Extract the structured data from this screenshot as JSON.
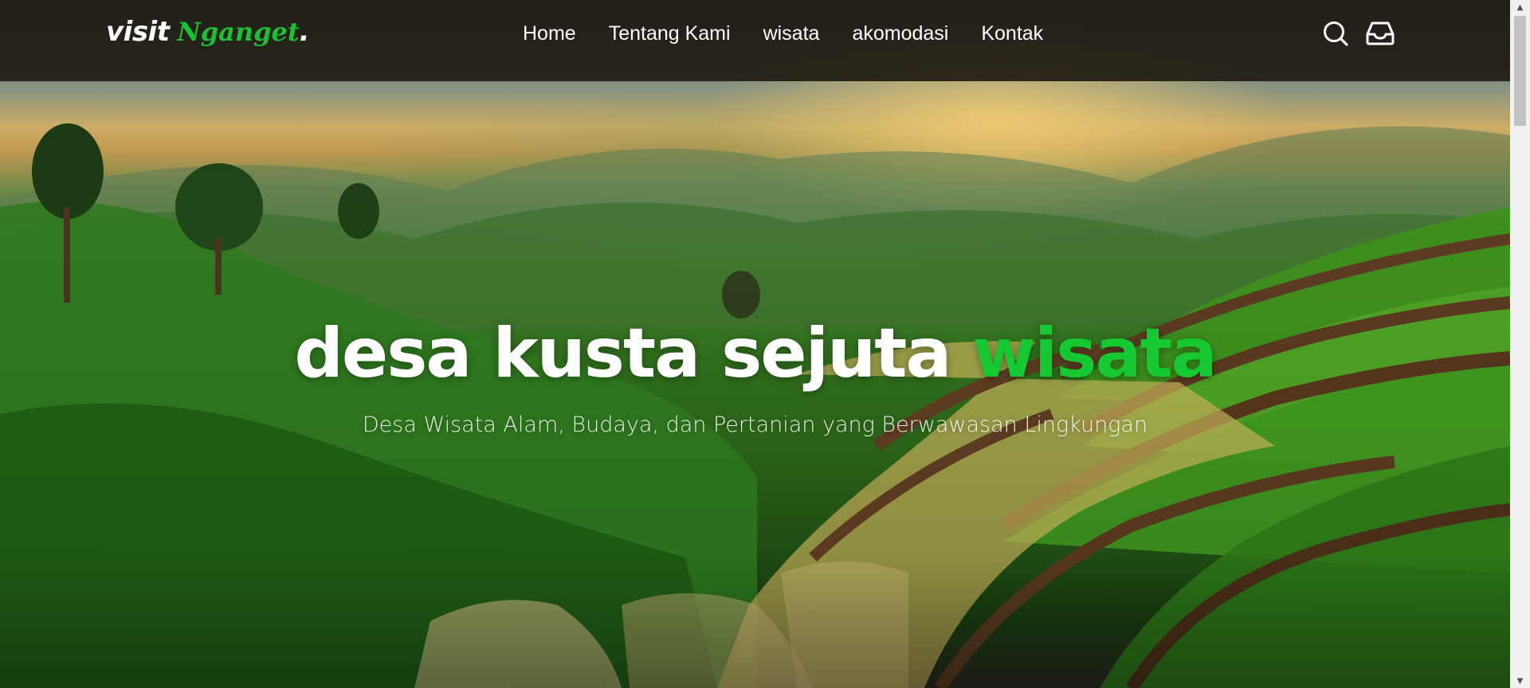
{
  "navbar": {
    "logo": {
      "word1": "visit",
      "word2": "Nganget",
      "dot": "."
    },
    "links": [
      {
        "label": "Home"
      },
      {
        "label": "Tentang Kami"
      },
      {
        "label": "wisata"
      },
      {
        "label": "akomodasi"
      },
      {
        "label": "Kontak"
      }
    ],
    "icons": {
      "search": "search-icon",
      "inbox": "inbox-icon"
    }
  },
  "hero": {
    "title_main": "desa kusta sejuta ",
    "title_accent": "wisata",
    "subtitle": "Desa Wisata Alam, Budaya, dan Pertanian yang Berwawasan Lingkungan"
  },
  "colors": {
    "accent": "#16c832",
    "navbar_bg": "#211b12",
    "text": "#ffffff"
  },
  "scrollbar": {
    "up_arrow": "▲",
    "down_arrow": "▼"
  }
}
